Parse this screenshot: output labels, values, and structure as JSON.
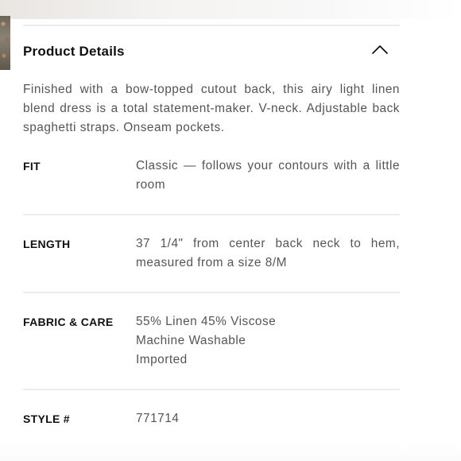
{
  "accordion": {
    "title": "Product Details",
    "toggle_icon": "chevron-up-icon",
    "description": "Finished with a bow-topped cutout back, this airy light linen blend dress is a total statement-maker. V-neck. Adjustable back spaghetti straps. Onseam pockets."
  },
  "specs": {
    "fit": {
      "label": "FIT",
      "value": "Classic — follows your contours with a little room"
    },
    "length": {
      "label": "LENGTH",
      "value": "37 1/4\" from center back neck to hem, measured from a size 8/M"
    },
    "fabric_care": {
      "label": "FABRIC & CARE",
      "lines": [
        "55% Linen 45% Viscose",
        "Machine Washable",
        "Imported"
      ]
    },
    "style": {
      "label": "STYLE #",
      "value": "771714"
    }
  }
}
